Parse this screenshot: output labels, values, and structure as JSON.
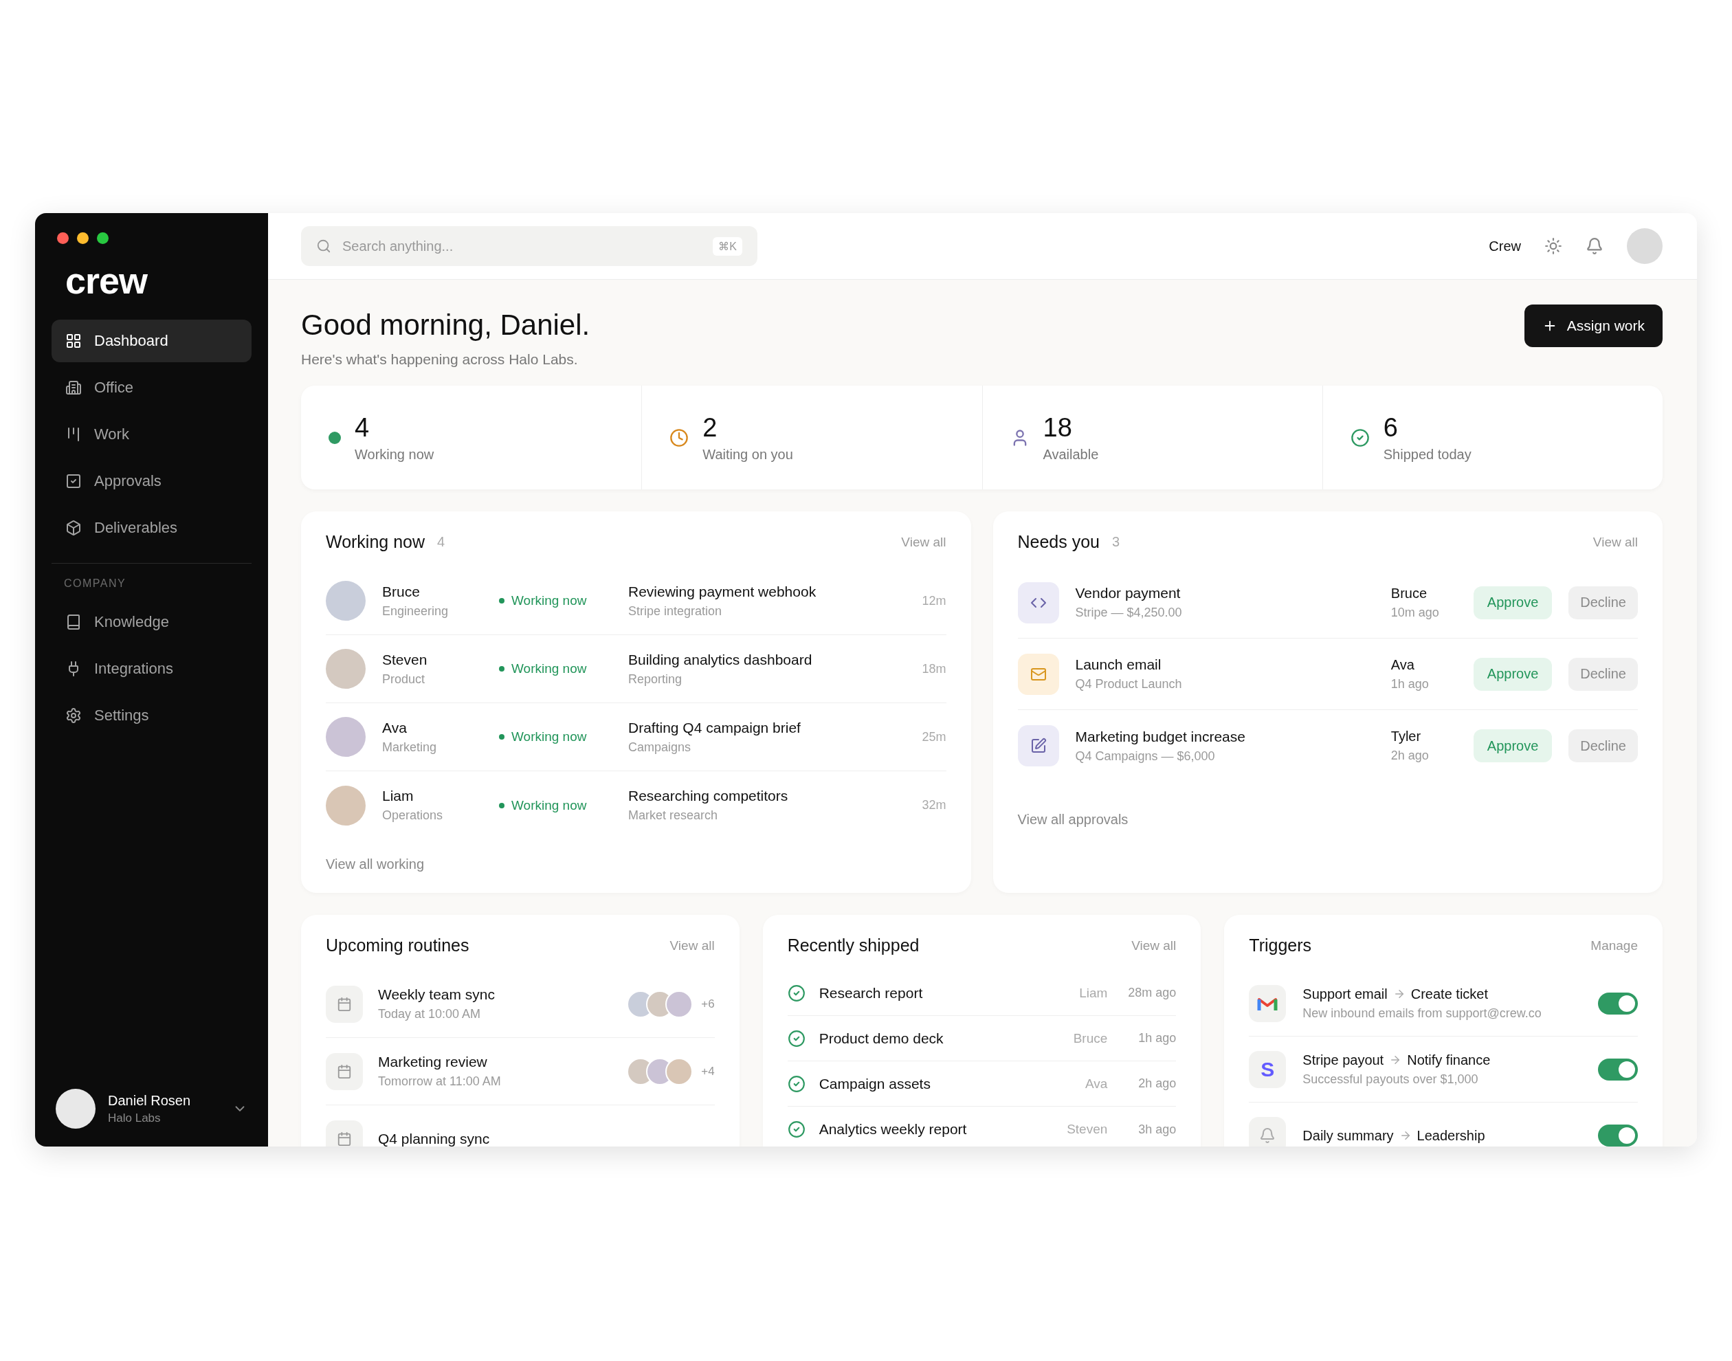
{
  "sidebar": {
    "logo": "crew",
    "items": [
      {
        "label": "Dashboard",
        "selected": true
      },
      {
        "label": "Office",
        "selected": false
      },
      {
        "label": "Work",
        "selected": false
      },
      {
        "label": "Approvals",
        "selected": false
      },
      {
        "label": "Deliverables",
        "selected": false
      }
    ],
    "section_label": "COMPANY",
    "section_items": [
      {
        "label": "Knowledge",
        "selected": false
      },
      {
        "label": "Integrations",
        "selected": false
      },
      {
        "label": "Settings",
        "selected": false
      }
    ],
    "user": {
      "name": "Daniel Rosen",
      "org": "Halo Labs"
    }
  },
  "topbar": {
    "search": {
      "placeholder": "Search anything...",
      "shortcut": "⌘K"
    },
    "workspace": "Crew"
  },
  "header": {
    "title": "Good morning, Daniel.",
    "subtitle": "Here's what's happening across Halo Labs.",
    "button": "Assign work"
  },
  "stats": [
    {
      "value": "4",
      "label": "Working now"
    },
    {
      "value": "2",
      "label": "Waiting on you"
    },
    {
      "value": "18",
      "label": "Available"
    },
    {
      "value": "6",
      "label": "Shipped today"
    }
  ],
  "working_now": {
    "title": "Working now",
    "count": "4",
    "view_all": "View all",
    "footer": "View all working",
    "rows": [
      {
        "name": "Bruce",
        "team": "Engineering",
        "status": "Working now",
        "task": "Reviewing payment webhook",
        "project": "Stripe integration",
        "time": "12m"
      },
      {
        "name": "Steven",
        "team": "Product",
        "status": "Working now",
        "task": "Building analytics dashboard",
        "project": "Reporting",
        "time": "18m"
      },
      {
        "name": "Ava",
        "team": "Marketing",
        "status": "Working now",
        "task": "Drafting Q4 campaign brief",
        "project": "Campaigns",
        "time": "25m"
      },
      {
        "name": "Liam",
        "team": "Operations",
        "status": "Working now",
        "task": "Researching competitors",
        "project": "Market research",
        "time": "32m"
      }
    ]
  },
  "needs_you": {
    "title": "Needs you",
    "count": "3",
    "view_all": "View all",
    "footer": "View all approvals",
    "rows": [
      {
        "title": "Vendor payment",
        "detail": "Stripe — $4,250.00",
        "person": "Bruce",
        "time": "10m ago",
        "approve": "Approve",
        "decline": "Decline"
      },
      {
        "title": "Launch email",
        "detail": "Q4 Product Launch",
        "person": "Ava",
        "time": "1h ago",
        "approve": "Approve",
        "decline": "Decline"
      },
      {
        "title": "Marketing budget increase",
        "detail": "Q4 Campaigns — $6,000",
        "person": "Tyler",
        "time": "2h ago",
        "approve": "Approve",
        "decline": "Decline"
      }
    ]
  },
  "routines": {
    "title": "Upcoming routines",
    "view_all": "View all",
    "rows": [
      {
        "title": "Weekly team sync",
        "when": "Today at 10:00 AM",
        "extra": "+6"
      },
      {
        "title": "Marketing review",
        "when": "Tomorrow at 11:00 AM",
        "extra": "+4"
      },
      {
        "title": "Q4 planning sync"
      }
    ]
  },
  "shipped": {
    "title": "Recently shipped",
    "view_all": "View all",
    "rows": [
      {
        "title": "Research report",
        "person": "Liam",
        "time": "28m ago"
      },
      {
        "title": "Product demo deck",
        "person": "Bruce",
        "time": "1h ago"
      },
      {
        "title": "Campaign assets",
        "person": "Ava",
        "time": "2h ago"
      },
      {
        "title": "Analytics weekly report",
        "person": "Steven",
        "time": "3h ago"
      }
    ]
  },
  "triggers": {
    "title": "Triggers",
    "manage": "Manage",
    "rows": [
      {
        "source": "Support email",
        "target": "Create ticket",
        "detail": "New inbound emails from support@crew.co",
        "on": true
      },
      {
        "logo": "S",
        "source": "Stripe payout",
        "target": "Notify finance",
        "detail": "Successful payouts over $1,000",
        "on": true
      },
      {
        "source": "Daily summary",
        "target": "Leadership",
        "on": true
      }
    ]
  }
}
